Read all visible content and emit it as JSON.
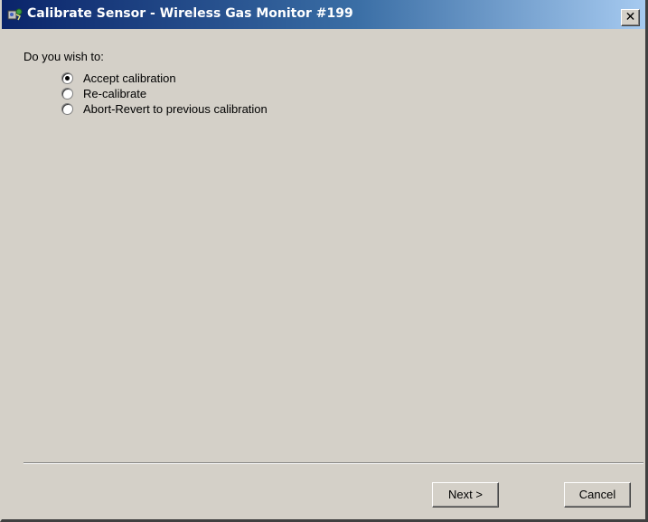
{
  "window": {
    "title": "Calibrate Sensor - Wireless Gas Monitor #199",
    "close_glyph": "✕",
    "app_icon": "gas-monitor-icon"
  },
  "content": {
    "prompt": "Do you wish to:",
    "options": [
      {
        "label": "Accept calibration",
        "checked": true
      },
      {
        "label": "Re-calibrate",
        "checked": false
      },
      {
        "label": "Abort-Revert to previous calibration",
        "checked": false
      }
    ]
  },
  "buttons": {
    "next_label": "Next >",
    "cancel_label": "Cancel"
  }
}
